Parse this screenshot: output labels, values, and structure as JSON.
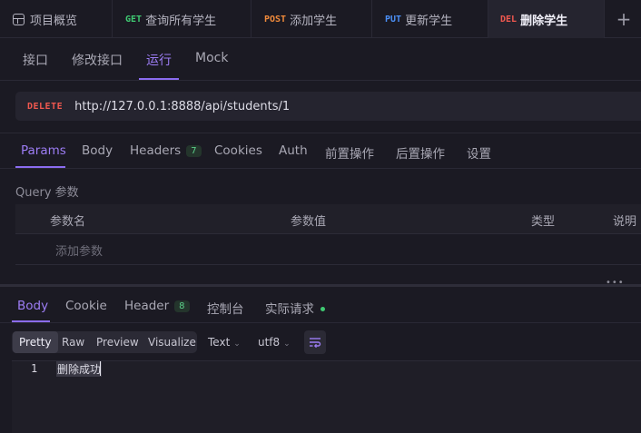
{
  "tabs": [
    {
      "method": "",
      "label": "项目概览",
      "method_color": ""
    },
    {
      "method": "GET",
      "label": "查询所有学生",
      "method_color": "#3fc972"
    },
    {
      "method": "POST",
      "label": "添加学生",
      "method_color": "#f08a3b"
    },
    {
      "method": "PUT",
      "label": "更新学生",
      "method_color": "#4b8ff5"
    },
    {
      "method": "DEL",
      "label": "删除学生",
      "method_color": "#f0584f"
    }
  ],
  "add_tab_icon": "plus-icon",
  "subnav": {
    "items": [
      "接口",
      "修改接口",
      "运行",
      "Mock"
    ],
    "active": "运行"
  },
  "request": {
    "method": "DELETE",
    "url": "http://127.0.0.1:8888/api/students/1"
  },
  "request_tabs": {
    "params": "Params",
    "body": "Body",
    "headers": "Headers",
    "headers_count": "7",
    "cookies": "Cookies",
    "auth": "Auth",
    "pre": "前置操作",
    "post": "后置操作",
    "settings": "设置"
  },
  "query": {
    "title": "Query 参数",
    "columns": [
      "参数名",
      "参数值",
      "类型",
      "说明"
    ],
    "add_placeholder": "添加参数"
  },
  "response_tabs": {
    "body": "Body",
    "cookie": "Cookie",
    "header": "Header",
    "header_count": "8",
    "console": "控制台",
    "actual": "实际请求"
  },
  "view": {
    "modes": [
      "Pretty",
      "Raw",
      "Preview",
      "Visualize"
    ],
    "active_mode": "Pretty",
    "format": "Text",
    "encoding": "utf8"
  },
  "editor": {
    "line_number": "1",
    "content": "删除成功"
  }
}
